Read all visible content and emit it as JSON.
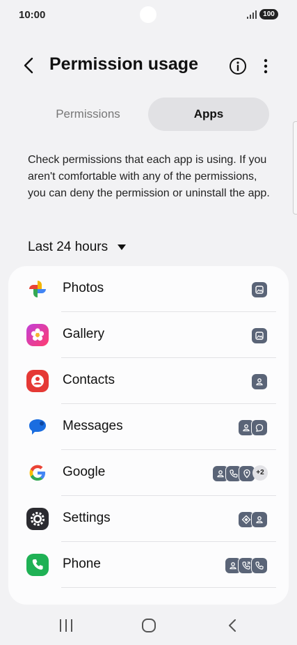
{
  "status_bar": {
    "time": "10:00",
    "battery": "100",
    "signal_icon": "signal-bars-icon"
  },
  "header": {
    "title": "Permission usage",
    "back_icon": "chevron-left-icon",
    "info_icon": "info-icon",
    "more_icon": "more-vertical-icon"
  },
  "tabs": [
    {
      "label": "Permissions",
      "selected": false
    },
    {
      "label": "Apps",
      "selected": true
    }
  ],
  "description": "Check permissions that each app is using. If you aren't comfortable with any of the permissions, you can deny the permission or uninstall the app.",
  "filter": {
    "label": "Last 24 hours"
  },
  "apps": [
    {
      "name": "Photos",
      "permissions": [
        "gallery"
      ]
    },
    {
      "name": "Gallery",
      "permissions": [
        "gallery"
      ]
    },
    {
      "name": "Contacts",
      "permissions": [
        "contacts"
      ]
    },
    {
      "name": "Messages",
      "permissions": [
        "contacts",
        "sms"
      ]
    },
    {
      "name": "Google",
      "permissions": [
        "contacts",
        "phone",
        "location"
      ],
      "more": "+2"
    },
    {
      "name": "Settings",
      "permissions": [
        "nearby",
        "contacts"
      ]
    },
    {
      "name": "Phone",
      "permissions": [
        "contacts",
        "call-log",
        "phone"
      ]
    }
  ],
  "colors": {
    "background": "#f2f2f4",
    "card": "#fcfcfd",
    "selected_tab": "#e1e1e4",
    "permission_chip": "#5a6477",
    "gallery_icon": "#e8308c",
    "contacts_icon": "#e53935",
    "messages_icon": "#1a6de0",
    "phone_icon": "#1fb155"
  },
  "nav_bar": {
    "recents_icon": "recents-icon",
    "home_icon": "home-icon",
    "back_icon": "nav-back-icon"
  }
}
